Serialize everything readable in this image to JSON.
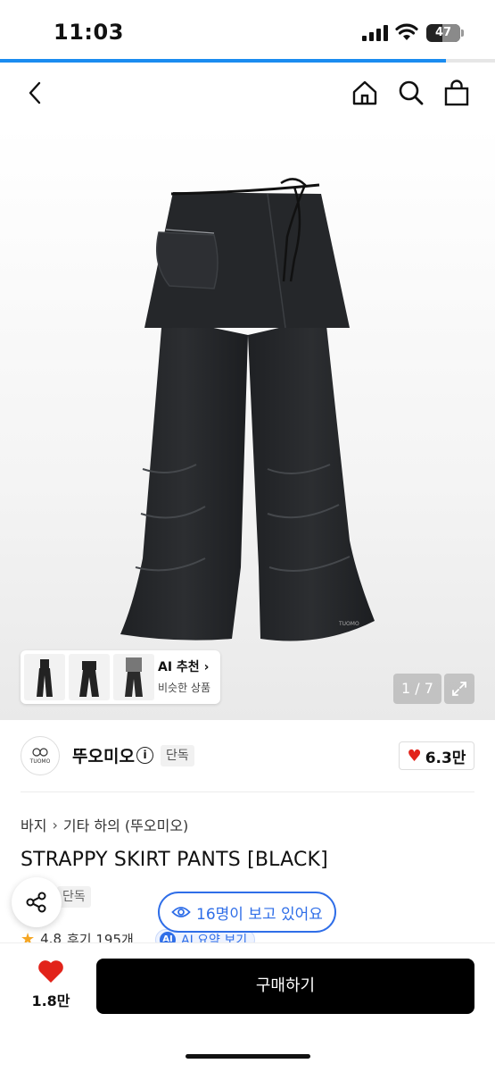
{
  "status_bar": {
    "time": "11:03",
    "battery": "47",
    "battery_percent": 47
  },
  "page_scroll_progress": 0.9,
  "nav": {
    "back_icon": "chevron-left-icon",
    "home_icon": "home-icon",
    "search_icon": "search-icon",
    "bag_icon": "shopping-bag-icon"
  },
  "gallery": {
    "counter": "1 / 7",
    "ai_recommend_title": "AI 추천",
    "ai_recommend_subtitle": "비슷한 상품",
    "watermark": "TUOMO"
  },
  "brand": {
    "logo_text": "TUOMO",
    "name": "뚜오미오",
    "exclusive_badge": "단독",
    "likes": "6.3만"
  },
  "breadcrumb": [
    "바지",
    "기타 하의 (뚜오미오)"
  ],
  "product": {
    "title": "STRAPPY SKIRT PANTS [BLACK]",
    "exclusive_badge": "단독",
    "rating": "4.8",
    "reviews": "후기 195개",
    "ai_summary": "AI 요약 보기"
  },
  "viewers_pill": "16명이 보고 있어요",
  "bottom_bar": {
    "favorite_count": "1.8만",
    "buy_label": "구매하기"
  },
  "colors": {
    "accent_blue": "#2f6ee8",
    "heart_red": "#e2231a",
    "progress_blue": "#1b8cf0"
  }
}
